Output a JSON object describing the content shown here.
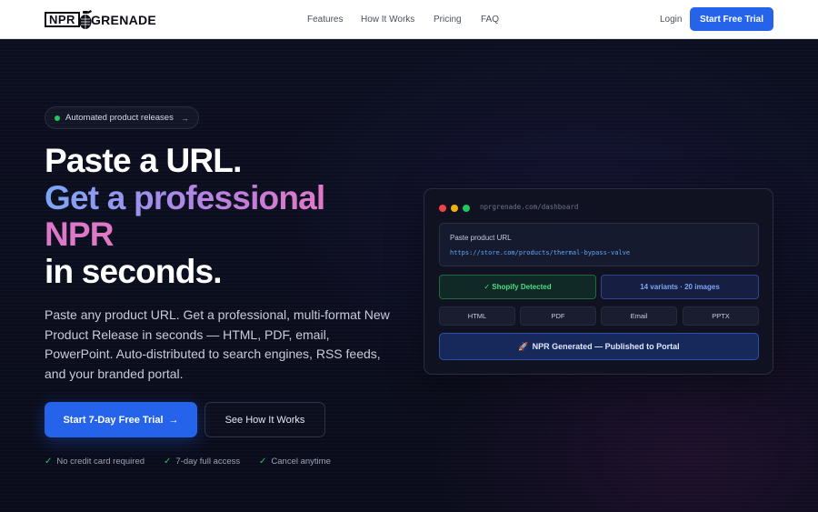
{
  "nav": {
    "logo_box": "NPR",
    "logo_text": "GRENADE",
    "links": [
      "Features",
      "How It Works",
      "Pricing",
      "FAQ"
    ],
    "login": "Login",
    "cta": "Start Free Trial"
  },
  "hero": {
    "badge": "Automated product releases",
    "headline_line1": "Paste a URL.",
    "headline_line2": "Get a professional",
    "headline_line3": "NPR",
    "headline_line4": "in seconds.",
    "subtext": "Paste any product URL. Get a professional, multi-format New Product Release in seconds — HTML, PDF, email, PowerPoint. Auto-distributed to search engines, RSS feeds, and your branded portal.",
    "cta_primary": "Start 7-Day Free Trial",
    "cta_secondary": "See How It Works",
    "checks": [
      "No credit card required",
      "7-day full access",
      "Cancel anytime"
    ]
  },
  "dashboard": {
    "url": "nprgrenade.com/dashboard",
    "input_label": "Paste product URL",
    "input_value": "https://store.com/products/thermal-bypass-valve",
    "shopify": "✓ Shopify Detected",
    "variants": "14 variants · 20 images",
    "formats": [
      "HTML",
      "PDF",
      "Email",
      "PPTX"
    ],
    "generated": "NPR Generated — Published to Portal"
  },
  "colors": {
    "accent": "#2563eb",
    "success": "#22c55e",
    "gradient_start": "#7aa7f7",
    "gradient_end": "#e07ac6"
  }
}
